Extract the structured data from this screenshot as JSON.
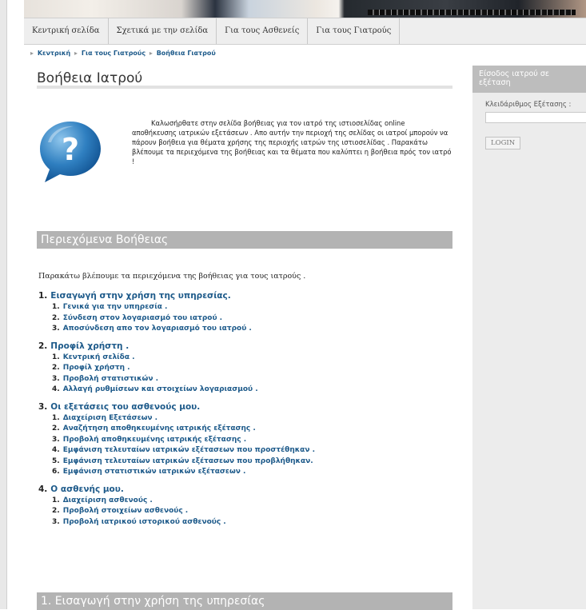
{
  "nav": {
    "items": [
      {
        "label": "Κεντρική σελίδα"
      },
      {
        "label": "Σχετικά με την σελίδα"
      },
      {
        "label": "Για τους Ασθενείς"
      },
      {
        "label": "Για τους Γιατρούς"
      }
    ]
  },
  "breadcrumb": {
    "items": [
      "Κεντρική",
      "Για τους Γιατρούς",
      "Βοήθεια Γιατρού"
    ]
  },
  "page": {
    "title": "Βοήθεια Ιατρού",
    "intro": "Καλωσήρθατε στην σελίδα βοήθειας για τον ιατρό της ιστιοσελίδας online αποθήκευσης ιατρικών εξετάσεων . Απο αυτήν την περιοχή της σελίδας οι ιατροί μπορούν να πάρουν βοήθεια για θέματα χρήσης της περιοχής ιατρών της ιστιοσελίδας . Παρακάτω βλέπουμε τα περιεχόμενα της βοήθειας και τα θέματα που καλύπτει η βοήθεια πρός τον ιατρό !",
    "contents_heading": "Περιεχόμενα Βοήθειας",
    "contents_lead": "Παρακάτω βλέπουμε τα περιεχόμενα της βοήθειας για τους ιατρούς .",
    "bottom_heading": "1. Εισαγωγή στην χρήση της υπηρεσίας",
    "icon": "help-question-icon",
    "accent_color": "#1d5a8a"
  },
  "toc": [
    {
      "num": "1.",
      "title": "Εισαγωγή στην χρήση της υπηρεσίας.",
      "items": [
        {
          "num": "1.",
          "label": "Γενικά για την υπηρεσία ."
        },
        {
          "num": "2.",
          "label": "Σύνδεση στον λογαριασμό του ιατρού ."
        },
        {
          "num": "3.",
          "label": "Αποσύνδεση απο τον λογαριασμό του ιατρού ."
        }
      ]
    },
    {
      "num": "2.",
      "title": "Προφίλ χρήστη .",
      "items": [
        {
          "num": "1.",
          "label": "Κεντρική σελίδα ."
        },
        {
          "num": "2.",
          "label": "Προφίλ χρήστη ."
        },
        {
          "num": "3.",
          "label": "Προβολή στατιστικών ."
        },
        {
          "num": "4.",
          "label": "Αλλαγή ρυθμίσεων και στοιχείων λογαριασμού ."
        }
      ]
    },
    {
      "num": "3.",
      "title": "Οι εξετάσεις του ασθενούς μου.",
      "items": [
        {
          "num": "1.",
          "label": "Διαχείριση Εξετάσεων ."
        },
        {
          "num": "2.",
          "label": "Αναζήτηση αποθηκευμένης ιατρικής εξέτασης ."
        },
        {
          "num": "3.",
          "label": "Προβολή αποθηκευμένης ιατρικής εξέτασης ."
        },
        {
          "num": "4.",
          "label": "Εμφάνιση τελευταίων ιατρικών εξέτασεων που προστέθηκαν ."
        },
        {
          "num": "5.",
          "label": "Εμφάνιση τελευταίων ιατρικών εξέτασεων που προβλήθηκαν."
        },
        {
          "num": "6.",
          "label": "Εμφάνιση στατιστικών ιατρικών εξέτασεων ."
        }
      ]
    },
    {
      "num": "4.",
      "title": "Ο ασθενής μου.",
      "items": [
        {
          "num": "1.",
          "label": "Διαχείριση ασθενούς ."
        },
        {
          "num": "2.",
          "label": "Προβολή στοιχείων ασθενούς ."
        },
        {
          "num": "3.",
          "label": "Προβολή ιατρικού ιστορικού ασθενούς ."
        }
      ]
    }
  ],
  "sidebar": {
    "title": "Είσοδος ιατρού σε εξέταση",
    "key_label": "Κλειδάριθμος Εξέτασης :",
    "key_value": "",
    "login_label": "LOGIN"
  }
}
